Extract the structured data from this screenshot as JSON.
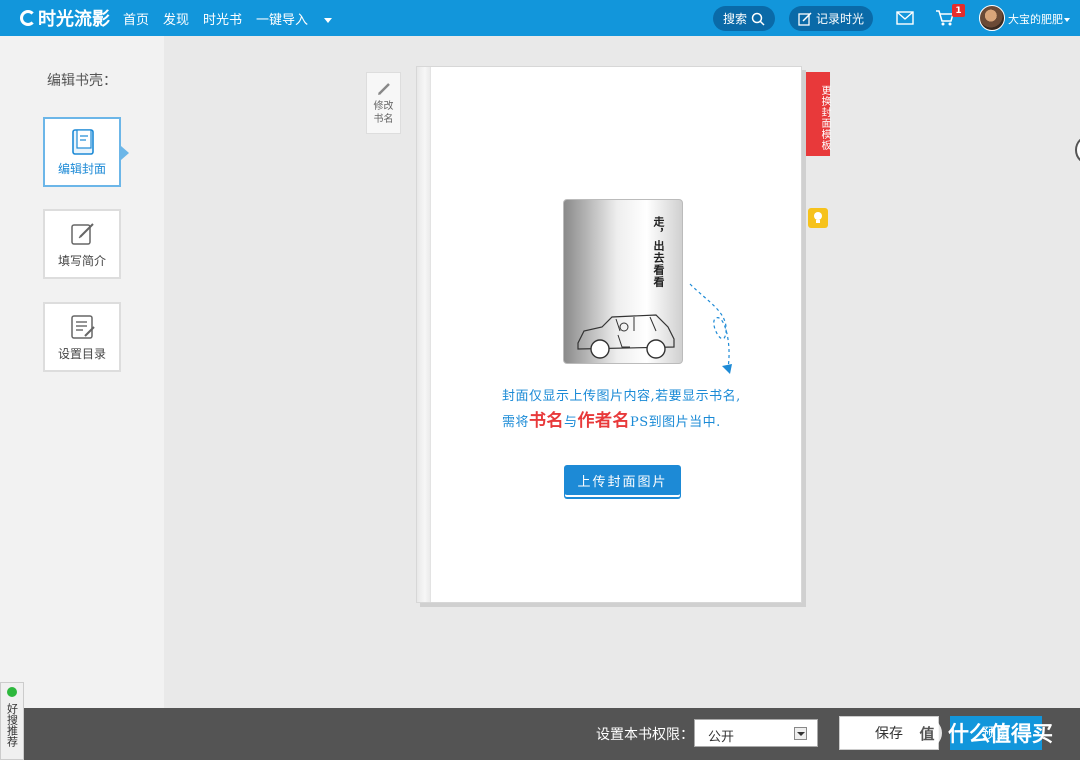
{
  "topbar": {
    "logo": "时光流影",
    "nav": [
      "首页",
      "发现",
      "时光书",
      "一键导入"
    ],
    "search_label": "搜索",
    "record_label": "记录时光",
    "cart_count": "1",
    "username": "大宝的肥肥"
  },
  "sidebar": {
    "title": "编辑书壳：",
    "items": [
      {
        "label": "编辑封面",
        "icon": "book-icon"
      },
      {
        "label": "填写简介",
        "icon": "edit-icon"
      },
      {
        "label": "设置目录",
        "icon": "list-edit-icon"
      }
    ]
  },
  "book": {
    "edit_name_line1": "修改",
    "edit_name_line2": "书名",
    "template_tab": "更换封面模板",
    "cover_title": "走，出去看看",
    "hint_line1": "封面仅显示上传图片内容,若要显示书名,",
    "hint_line2_a": "需将",
    "hint_line2_b": "书名",
    "hint_line2_c": "与",
    "hint_line2_d": "作者名",
    "hint_line2_e": "PS到图片当中.",
    "upload_label": "上传封面图片"
  },
  "bottombar": {
    "permission_label": "设置本书权限：",
    "permission_value": "公开",
    "save_label": "保存",
    "preview_label": "预览"
  },
  "float_tab": {
    "label": "好搜推荐"
  },
  "watermark": {
    "icon_text": "值",
    "text": "什么值得买"
  },
  "colors": {
    "topbar": "#1296db",
    "template_tab": "#e8393a",
    "accent_blue": "#1d8ad6",
    "bottombar": "#545454"
  }
}
